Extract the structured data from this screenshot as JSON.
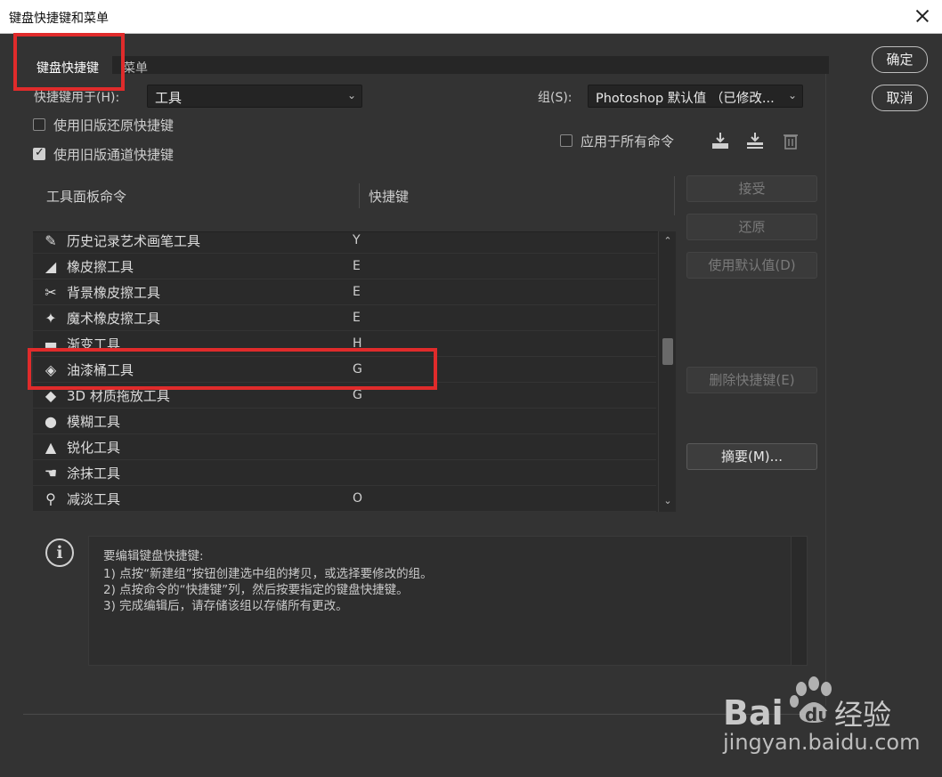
{
  "window": {
    "title": "键盘快捷键和菜单"
  },
  "tabs": [
    {
      "label": "键盘快捷键",
      "active": true
    },
    {
      "label": "菜单",
      "active": false
    }
  ],
  "shortcuts_for": {
    "label": "快捷键用于(H):",
    "value": "工具"
  },
  "group": {
    "label": "组(S):",
    "value": "Photoshop 默认值 （已修改..."
  },
  "checkboxes": {
    "legacy_undo": {
      "label": "使用旧版还原快捷键",
      "checked": false
    },
    "legacy_channel": {
      "label": "使用旧版通道快捷键",
      "checked": true
    },
    "apply_all": {
      "label": "应用于所有命令",
      "checked": false
    }
  },
  "dialog_buttons": {
    "ok": "确定",
    "cancel": "取消"
  },
  "side_buttons": {
    "accept": "接受",
    "undo": "还原",
    "use_default": "使用默认值(D)",
    "delete_shortcut": "删除快捷键(E)",
    "summarize": "摘要(M)..."
  },
  "table": {
    "col_command": "工具面板命令",
    "col_shortcut": "快捷键",
    "rows": [
      {
        "name": "历史记录艺术画笔工具",
        "key": "Y",
        "icon": "art-history-brush-icon",
        "glyph": "✎"
      },
      {
        "name": "橡皮擦工具",
        "key": "E",
        "icon": "eraser-icon",
        "glyph": "◢"
      },
      {
        "name": "背景橡皮擦工具",
        "key": "E",
        "icon": "background-eraser-icon",
        "glyph": "✂"
      },
      {
        "name": "魔术橡皮擦工具",
        "key": "E",
        "icon": "magic-eraser-icon",
        "glyph": "✦"
      },
      {
        "name": "渐变工具",
        "key": "H",
        "icon": "gradient-icon",
        "glyph": "▬"
      },
      {
        "name": "油漆桶工具",
        "key": "G",
        "icon": "paint-bucket-icon",
        "glyph": "◈"
      },
      {
        "name": "3D 材质拖放工具",
        "key": "G",
        "icon": "3d-material-drop-icon",
        "glyph": "◆"
      },
      {
        "name": "模糊工具",
        "key": "",
        "icon": "blur-icon",
        "glyph": "●"
      },
      {
        "name": "锐化工具",
        "key": "",
        "icon": "sharpen-icon",
        "glyph": "▲"
      },
      {
        "name": "涂抹工具",
        "key": "",
        "icon": "smudge-icon",
        "glyph": "☚"
      },
      {
        "name": "减淡工具",
        "key": "O",
        "icon": "dodge-icon",
        "glyph": "⚲"
      }
    ]
  },
  "info": {
    "lines": [
      "要编辑键盘快捷键:",
      "1) 点按“新建组”按钮创建选中组的拷贝，或选择要修改的组。",
      "2) 点按命令的“快捷键”列，然后按要指定的键盘快捷键。",
      "3) 完成编辑后，请存储该组以存储所有更改。"
    ]
  },
  "watermark": {
    "logo_text": "Bai du 经验",
    "site": "jingyan.baidu.com"
  },
  "colors": {
    "highlight": "#e02b2b",
    "background": "#333333"
  }
}
